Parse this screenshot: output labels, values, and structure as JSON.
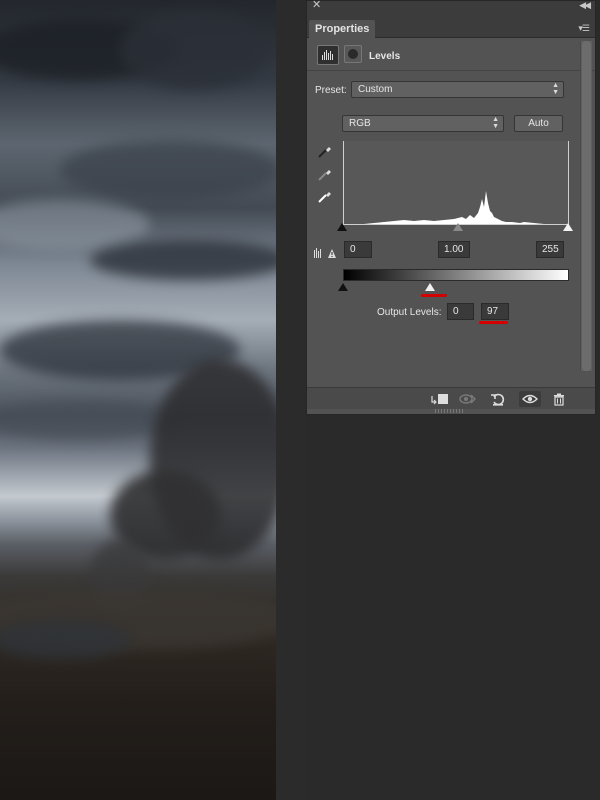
{
  "panel": {
    "tab_label": "Properties",
    "adjustment_title": "Levels",
    "preset_label": "Preset:",
    "preset_value": "Custom",
    "channel_value": "RGB",
    "auto_label": "Auto",
    "input_levels": {
      "shadows": "0",
      "midtones": "1.00",
      "highlights": "255"
    },
    "output_label": "Output Levels:",
    "output_levels": {
      "black": "0",
      "white": "97"
    }
  },
  "icons": {
    "close": "close-icon",
    "collapse": "collapse-panel-icon",
    "panel_menu": "panel-menu-icon",
    "levels": "levels-icon",
    "mask": "mask-icon",
    "eyedroppers": [
      "black-point-eyedropper-icon",
      "gray-point-eyedropper-icon",
      "white-point-eyedropper-icon"
    ],
    "clipping_warning": "clipping-warning-icon",
    "bottom_bar": [
      "clip-to-layer-icon",
      "view-previous-state-icon",
      "reset-icon",
      "toggle-visibility-icon",
      "delete-icon"
    ]
  },
  "colors": {
    "panel_bg": "#535353",
    "highlight_annotation": "#d40000"
  }
}
